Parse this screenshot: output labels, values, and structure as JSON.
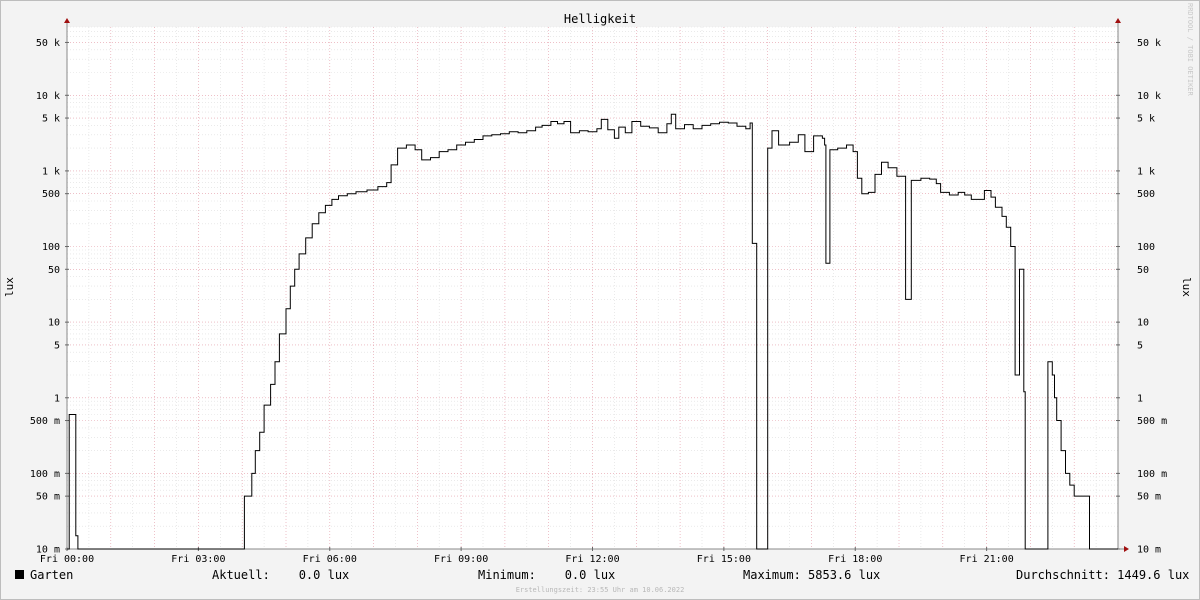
{
  "chart_data": {
    "type": "line",
    "title": "Helligkeit",
    "ylabel": "lux",
    "y_scale": "log",
    "ylim": [
      0.01,
      80000
    ],
    "y_ticks": [
      {
        "v": 50000,
        "label": "50 k"
      },
      {
        "v": 10000,
        "label": "10 k"
      },
      {
        "v": 5000,
        "label": "5 k"
      },
      {
        "v": 1000,
        "label": "1 k"
      },
      {
        "v": 500,
        "label": "500"
      },
      {
        "v": 100,
        "label": "100"
      },
      {
        "v": 50,
        "label": "50"
      },
      {
        "v": 10,
        "label": "10"
      },
      {
        "v": 5,
        "label": "5"
      },
      {
        "v": 1,
        "label": "1"
      },
      {
        "v": 0.5,
        "label": "500 m"
      },
      {
        "v": 0.1,
        "label": "100 m"
      },
      {
        "v": 0.05,
        "label": "50 m"
      },
      {
        "v": 0.01,
        "label": "10 m"
      }
    ],
    "x_unit": "hours",
    "xlim": [
      0,
      24
    ],
    "x_ticks": [
      {
        "v": 0,
        "label": "Fri 00:00"
      },
      {
        "v": 3,
        "label": "Fri 03:00"
      },
      {
        "v": 6,
        "label": "Fri 06:00"
      },
      {
        "v": 9,
        "label": "Fri 09:00"
      },
      {
        "v": 12,
        "label": "Fri 12:00"
      },
      {
        "v": 15,
        "label": "Fri 15:00"
      },
      {
        "v": 18,
        "label": "Fri 18:00"
      },
      {
        "v": 21,
        "label": "Fri 21:00"
      }
    ],
    "grid": true,
    "series": [
      {
        "name": "Garten",
        "color": "#000000",
        "points": [
          [
            0,
            0
          ],
          [
            0.05,
            0.6
          ],
          [
            0.18,
            0.6
          ],
          [
            0.2,
            0.015
          ],
          [
            0.25,
            0
          ],
          [
            4.0,
            0
          ],
          [
            4.05,
            0.05
          ],
          [
            4.2,
            0.05
          ],
          [
            4.22,
            0.1
          ],
          [
            4.3,
            0.2
          ],
          [
            4.4,
            0.35
          ],
          [
            4.5,
            0.8
          ],
          [
            4.65,
            1.5
          ],
          [
            4.75,
            3
          ],
          [
            4.85,
            7
          ],
          [
            5.0,
            15
          ],
          [
            5.1,
            30
          ],
          [
            5.2,
            50
          ],
          [
            5.3,
            80
          ],
          [
            5.45,
            130
          ],
          [
            5.6,
            200
          ],
          [
            5.75,
            280
          ],
          [
            5.9,
            350
          ],
          [
            6.05,
            420
          ],
          [
            6.2,
            470
          ],
          [
            6.4,
            500
          ],
          [
            6.6,
            530
          ],
          [
            6.85,
            560
          ],
          [
            7.1,
            620
          ],
          [
            7.3,
            700
          ],
          [
            7.4,
            1200
          ],
          [
            7.55,
            2000
          ],
          [
            7.75,
            2200
          ],
          [
            7.95,
            1900
          ],
          [
            8.1,
            1400
          ],
          [
            8.3,
            1500
          ],
          [
            8.5,
            1800
          ],
          [
            8.7,
            1900
          ],
          [
            8.9,
            2200
          ],
          [
            9.1,
            2400
          ],
          [
            9.3,
            2600
          ],
          [
            9.5,
            2900
          ],
          [
            9.7,
            3000
          ],
          [
            9.9,
            3100
          ],
          [
            10.1,
            3300
          ],
          [
            10.3,
            3200
          ],
          [
            10.5,
            3400
          ],
          [
            10.7,
            3800
          ],
          [
            10.85,
            4000
          ],
          [
            11.05,
            4500
          ],
          [
            11.2,
            4200
          ],
          [
            11.35,
            4500
          ],
          [
            11.5,
            3200
          ],
          [
            11.7,
            3400
          ],
          [
            11.9,
            3300
          ],
          [
            12.1,
            3600
          ],
          [
            12.2,
            4800
          ],
          [
            12.35,
            3500
          ],
          [
            12.5,
            2700
          ],
          [
            12.6,
            3800
          ],
          [
            12.75,
            3200
          ],
          [
            12.9,
            4500
          ],
          [
            13.1,
            3900
          ],
          [
            13.3,
            3700
          ],
          [
            13.5,
            3200
          ],
          [
            13.7,
            4200
          ],
          [
            13.8,
            5600
          ],
          [
            13.9,
            3600
          ],
          [
            14.1,
            4100
          ],
          [
            14.3,
            3600
          ],
          [
            14.5,
            4000
          ],
          [
            14.7,
            4200
          ],
          [
            14.9,
            4400
          ],
          [
            15.1,
            4300
          ],
          [
            15.3,
            3900
          ],
          [
            15.5,
            3600
          ],
          [
            15.6,
            4300
          ],
          [
            15.65,
            110
          ],
          [
            15.72,
            110
          ],
          [
            15.75,
            0
          ],
          [
            15.95,
            0
          ],
          [
            16.0,
            2000
          ],
          [
            16.1,
            3400
          ],
          [
            16.25,
            2200
          ],
          [
            16.5,
            2400
          ],
          [
            16.7,
            3000
          ],
          [
            16.85,
            1800
          ],
          [
            17.05,
            2900
          ],
          [
            17.25,
            2700
          ],
          [
            17.3,
            2200
          ],
          [
            17.33,
            60
          ],
          [
            17.38,
            60
          ],
          [
            17.42,
            1900
          ],
          [
            17.6,
            2000
          ],
          [
            17.8,
            2200
          ],
          [
            17.95,
            1800
          ],
          [
            18.05,
            800
          ],
          [
            18.15,
            500
          ],
          [
            18.3,
            520
          ],
          [
            18.45,
            900
          ],
          [
            18.6,
            1300
          ],
          [
            18.75,
            1100
          ],
          [
            18.95,
            850
          ],
          [
            19.1,
            850
          ],
          [
            19.15,
            20
          ],
          [
            19.22,
            20
          ],
          [
            19.28,
            750
          ],
          [
            19.5,
            800
          ],
          [
            19.7,
            780
          ],
          [
            19.85,
            680
          ],
          [
            19.95,
            520
          ],
          [
            20.15,
            480
          ],
          [
            20.35,
            520
          ],
          [
            20.5,
            480
          ],
          [
            20.65,
            420
          ],
          [
            20.85,
            420
          ],
          [
            20.95,
            550
          ],
          [
            21.1,
            450
          ],
          [
            21.2,
            330
          ],
          [
            21.35,
            250
          ],
          [
            21.45,
            180
          ],
          [
            21.55,
            100
          ],
          [
            21.65,
            2
          ],
          [
            21.7,
            2
          ],
          [
            21.75,
            50
          ],
          [
            21.82,
            50
          ],
          [
            21.85,
            1.2
          ],
          [
            21.88,
            0.01
          ],
          [
            21.9,
            0
          ],
          [
            22.35,
            0
          ],
          [
            22.4,
            3
          ],
          [
            22.5,
            2
          ],
          [
            22.55,
            1
          ],
          [
            22.6,
            0.5
          ],
          [
            22.7,
            0.2
          ],
          [
            22.8,
            0.1
          ],
          [
            22.9,
            0.07
          ],
          [
            23.0,
            0.05
          ],
          [
            23.3,
            0.05
          ],
          [
            23.35,
            0.01
          ],
          [
            23.4,
            0
          ],
          [
            24.0,
            0
          ]
        ]
      }
    ]
  },
  "watermark": "RRDTOOL / TOBI OETIKER",
  "legend": {
    "name": "Garten",
    "aktuell": "Aktuell:    0.0 lux",
    "minimum": "Minimum:    0.0 lux",
    "maximum": "Maximum: 5853.6 lux",
    "durchschnitt": "Durchschnitt: 1449.6 lux"
  },
  "footer": "Erstellungszeit: 23:55 Uhr am 10.06.2022"
}
